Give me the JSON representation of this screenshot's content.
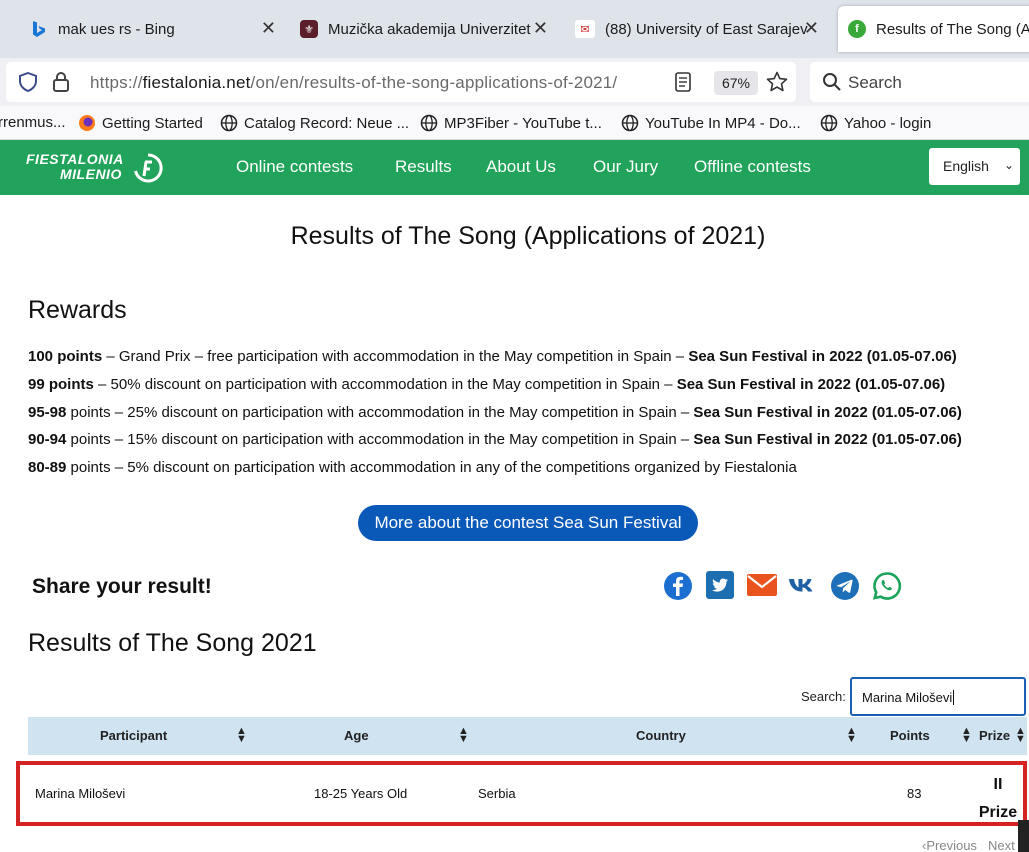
{
  "browser": {
    "tabs": [
      {
        "title": "mak ues rs - Bing",
        "icon": "bing-icon"
      },
      {
        "title": "Muzička akademija Univerzitet",
        "icon": "academy-crest-icon"
      },
      {
        "title": "(88) University of East Sarajevo",
        "icon": "university-logo-icon"
      },
      {
        "title": "Results of The Song (Ap",
        "icon": "fiestalonia-favicon"
      }
    ],
    "url_prefix": "https://",
    "url_domain": "fiestalonia.net",
    "url_path": "/on/en/results-of-the-song-applications-of-2021/",
    "zoom": "67%",
    "search_placeholder": "Search",
    "bookmarks": [
      {
        "label": "rrenmus...",
        "icon": "none"
      },
      {
        "label": "Getting Started",
        "icon": "firefox-icon"
      },
      {
        "label": "Catalog Record: Neue ...",
        "icon": "globe-icon"
      },
      {
        "label": "MP3Fiber - YouTube t...",
        "icon": "globe-icon"
      },
      {
        "label": "YouTube In MP4 - Do...",
        "icon": "globe-icon"
      },
      {
        "label": "Yahoo - login",
        "icon": "globe-icon"
      }
    ]
  },
  "site": {
    "logo_line1": "FIESTALONIA",
    "logo_line2": "MILENIO",
    "nav": [
      "Online contests",
      "Results",
      "About Us",
      "Our Jury",
      "Offline contests"
    ],
    "language": "English",
    "accent_color": "#22a35b"
  },
  "page": {
    "title": "Results of The Song (Applications of 2021)",
    "rewards_heading": "Rewards",
    "rewards": [
      {
        "points": "100 points",
        "bold_points": true,
        "text": " – Grand Prix – free participation with accommodation in the May competition in Spain – ",
        "festival": "Sea Sun Festival in 2022 (01.05-07.06)"
      },
      {
        "points": "99 points",
        "bold_points": true,
        "text": " – 50% discount on participation with accommodation in the May competition in Spain – ",
        "festival": "Sea Sun Festival in 2022 (01.05-07.06)"
      },
      {
        "points": "95-98",
        "bold_points": true,
        "suffix": " points",
        "text": " – 25% discount on participation with accommodation in the May competition in Spain – ",
        "festival": "Sea Sun Festival in 2022 (01.05-07.06)"
      },
      {
        "points": "90-94",
        "bold_points": true,
        "suffix": " points",
        "text": " – 15% discount on participation with accommodation in the May competition in Spain – ",
        "festival": "Sea Sun Festival in 2022 (01.05-07.06)"
      },
      {
        "points": "80-89",
        "bold_points": true,
        "suffix": " points",
        "text": " – 5% discount on participation with accommodation in any of the competitions organized by Fiestalonia",
        "festival": ""
      }
    ],
    "more_button": "More about the contest Sea Sun Festival",
    "share_label": "Share your result!",
    "share_icons": [
      "facebook-icon",
      "twitter-icon",
      "email-icon",
      "vk-icon",
      "telegram-icon",
      "whatsapp-icon"
    ],
    "results_heading": "Results of The Song 2021",
    "search_label": "Search:",
    "search_value": "Marina Miloševi",
    "columns": [
      "Participant",
      "Age",
      "Country",
      "Points",
      "Prize"
    ],
    "rows": [
      {
        "participant": "Marina Miloševi",
        "age": "18-25 Years Old",
        "country": "Serbia",
        "points": "83",
        "prize_line1": "II",
        "prize_line2": "Prize"
      }
    ],
    "pager_prev": "Previous",
    "pager_next": "Next"
  }
}
